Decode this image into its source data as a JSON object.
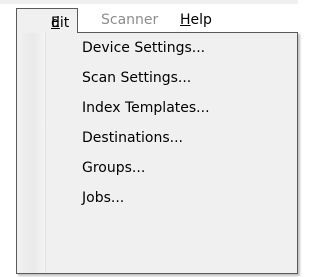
{
  "menubar": {
    "menus": [
      {
        "label": "Edit",
        "state": "open"
      },
      {
        "label": "Scanner",
        "state": "disabled"
      },
      {
        "label": "Help",
        "state": "normal"
      }
    ]
  },
  "edit_menu": {
    "items": [
      {
        "label": "Device Settings..."
      },
      {
        "label": "Scan Settings..."
      },
      {
        "label": "Index Templates..."
      },
      {
        "label": "Destinations..."
      },
      {
        "label": "Groups..."
      },
      {
        "label": "Jobs..."
      }
    ]
  },
  "colors": {
    "menu_background": "#f0f0f0",
    "menu_border": "#5a5a5a",
    "disabled_text": "#8c8c8c",
    "text": "#000000"
  }
}
